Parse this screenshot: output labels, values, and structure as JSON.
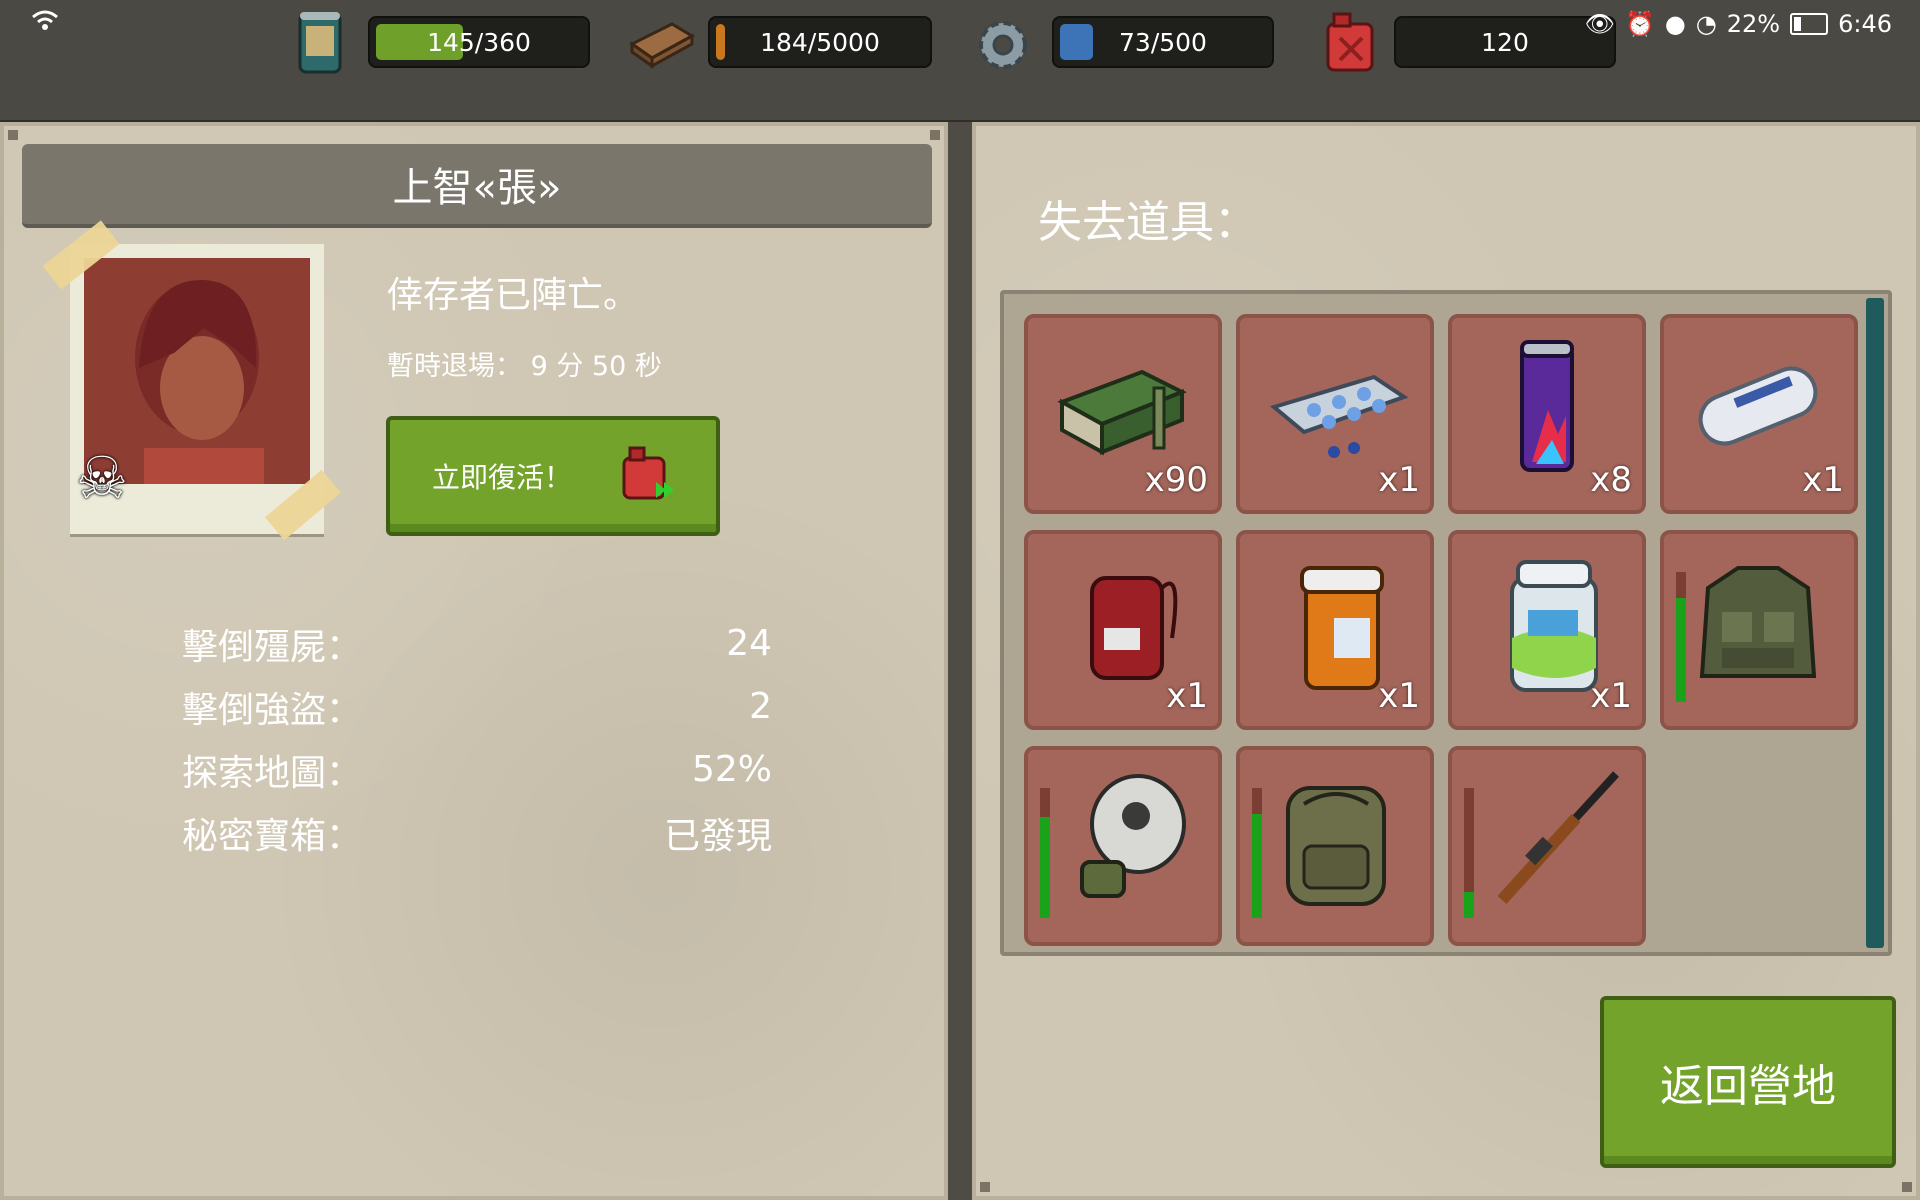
{
  "status_bar": {
    "battery_percent": "22%",
    "time": "6:46"
  },
  "resources": [
    {
      "icon": "food-can-icon",
      "value": "145/360",
      "fill": 0.4,
      "color": "#6fa02a"
    },
    {
      "icon": "wood-plank-icon",
      "value": "184/5000",
      "fill": 0.04,
      "color": "#c9781f"
    },
    {
      "icon": "water-bottle-icon",
      "value": "73/500",
      "fill": 0.15,
      "color": "#3d74b8"
    },
    {
      "icon": "fuel-can-icon",
      "value": "120",
      "fill": 0,
      "color": "#c23333"
    }
  ],
  "character": {
    "name": "上智«張»",
    "fallen_text": "倖存者已陣亡。",
    "timer_label": "暫時退場：",
    "timer_value": "9 分 50 秒",
    "revive_label": "立即復活！"
  },
  "stats": [
    {
      "label": "擊倒殭屍：",
      "value": "24"
    },
    {
      "label": "擊倒強盜：",
      "value": "2"
    },
    {
      "label": "探索地圖：",
      "value": "52%"
    },
    {
      "label": "秘密寶箱：",
      "value": "已發現"
    }
  ],
  "lost_items": {
    "title": "失去道具：",
    "items": [
      {
        "icon": "ammo-box-icon",
        "qty": "x90"
      },
      {
        "icon": "pill-blister-icon",
        "qty": "x1"
      },
      {
        "icon": "energy-drink-icon",
        "qty": "x8"
      },
      {
        "icon": "bandage-roll-icon",
        "qty": "x1"
      },
      {
        "icon": "blood-bag-icon",
        "qty": "x1"
      },
      {
        "icon": "pill-bottle-icon",
        "qty": "x1"
      },
      {
        "icon": "vitamin-jar-icon",
        "qty": "x1"
      },
      {
        "icon": "tactical-vest-icon",
        "qty": "",
        "durability": 0.8
      },
      {
        "icon": "gas-mask-icon",
        "qty": "",
        "durability": 0.78
      },
      {
        "icon": "backpack-icon",
        "qty": "",
        "durability": 0.8
      },
      {
        "icon": "rifle-icon",
        "qty": "",
        "durability": 0.2
      }
    ]
  },
  "return_label": "返回營地"
}
